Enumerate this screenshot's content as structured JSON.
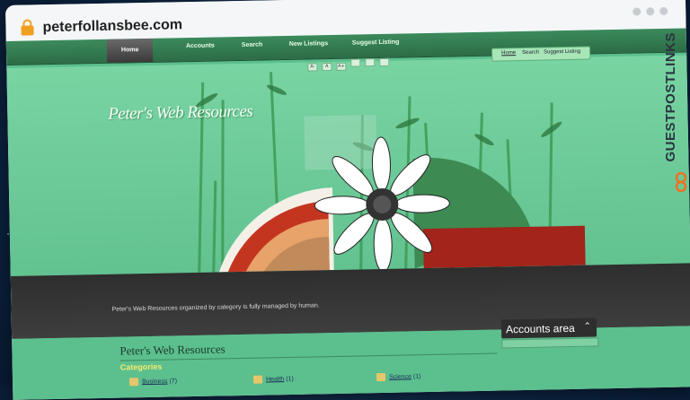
{
  "browser": {
    "url": "peterfollansbee.com"
  },
  "nav": {
    "items": [
      "Home",
      "Accounts",
      "Search",
      "New Listings",
      "Suggest Listing"
    ],
    "active": "Home"
  },
  "top_links": [
    "Home",
    "Search",
    "Suggest Listing"
  ],
  "font_size_controls": [
    "A-",
    "A",
    "A+",
    "",
    "",
    ""
  ],
  "hero": {
    "title": "Peter's Web Resources",
    "tagline": "Peter's Web Resources organized by category is fully managed by human."
  },
  "content": {
    "title": "Peter's Web Resources",
    "categories_heading": "Categories",
    "categories": [
      {
        "name": "Business",
        "count": "(7)"
      },
      {
        "name": "Health",
        "count": "(1)"
      },
      {
        "name": "Science",
        "count": "(1)"
      }
    ]
  },
  "sidebar": {
    "accounts_label": "Accounts area",
    "accounts_icon": "chevron-up-icon"
  },
  "watermark": {
    "text": "GUESTPOSTLINKS"
  },
  "colors": {
    "site_green": "#5cbf8e",
    "nav_green": "#2c6c46",
    "dark_band": "#333333",
    "heading_yellow": "#f4ea6c",
    "lock_orange": "#f0a020",
    "logo_orange": "#f07020"
  }
}
